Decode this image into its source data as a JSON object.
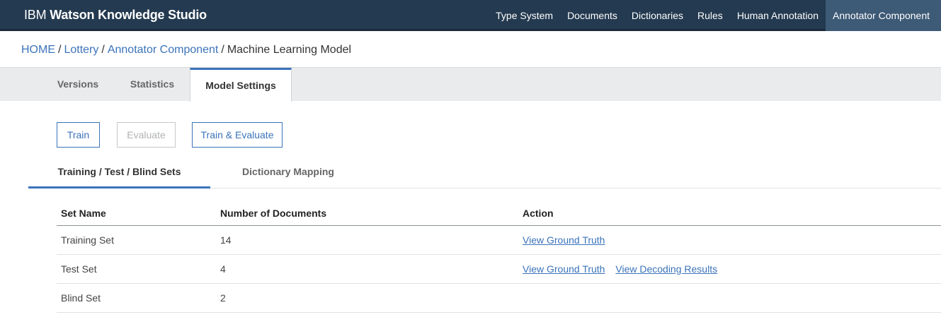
{
  "app": {
    "brand_ibm": "IBM",
    "brand_name": "Watson Knowledge Studio"
  },
  "topnav": {
    "items": [
      {
        "label": "Type System"
      },
      {
        "label": "Documents"
      },
      {
        "label": "Dictionaries"
      },
      {
        "label": "Rules"
      },
      {
        "label": "Human Annotation"
      },
      {
        "label": "Annotator Component",
        "active": true
      }
    ]
  },
  "breadcrumb": {
    "items": [
      "HOME",
      "Lottery",
      "Annotator Component"
    ],
    "separator": "/",
    "current": "Machine Learning Model"
  },
  "model_tabs": [
    {
      "label": "Versions"
    },
    {
      "label": "Statistics"
    },
    {
      "label": "Model Settings",
      "active": true
    }
  ],
  "actions": {
    "train": "Train",
    "evaluate": "Evaluate",
    "train_evaluate": "Train & Evaluate"
  },
  "sub_tabs": [
    {
      "label": "Training / Test / Blind Sets",
      "active": true
    },
    {
      "label": "Dictionary Mapping"
    }
  ],
  "table": {
    "headers": [
      "Set Name",
      "Number of Documents",
      "Action"
    ],
    "rows": [
      {
        "name": "Training Set",
        "count": "14",
        "actions": [
          "View Ground Truth"
        ]
      },
      {
        "name": "Test Set",
        "count": "4",
        "actions": [
          "View Ground Truth",
          "View Decoding Results"
        ]
      },
      {
        "name": "Blind Set",
        "count": "2",
        "actions": []
      }
    ]
  },
  "colors": {
    "header_bg": "#243a50",
    "active_nav_bg": "#3d5a76",
    "accent_blue": "#3b73b9",
    "tabs_bg": "#e9ebec"
  }
}
